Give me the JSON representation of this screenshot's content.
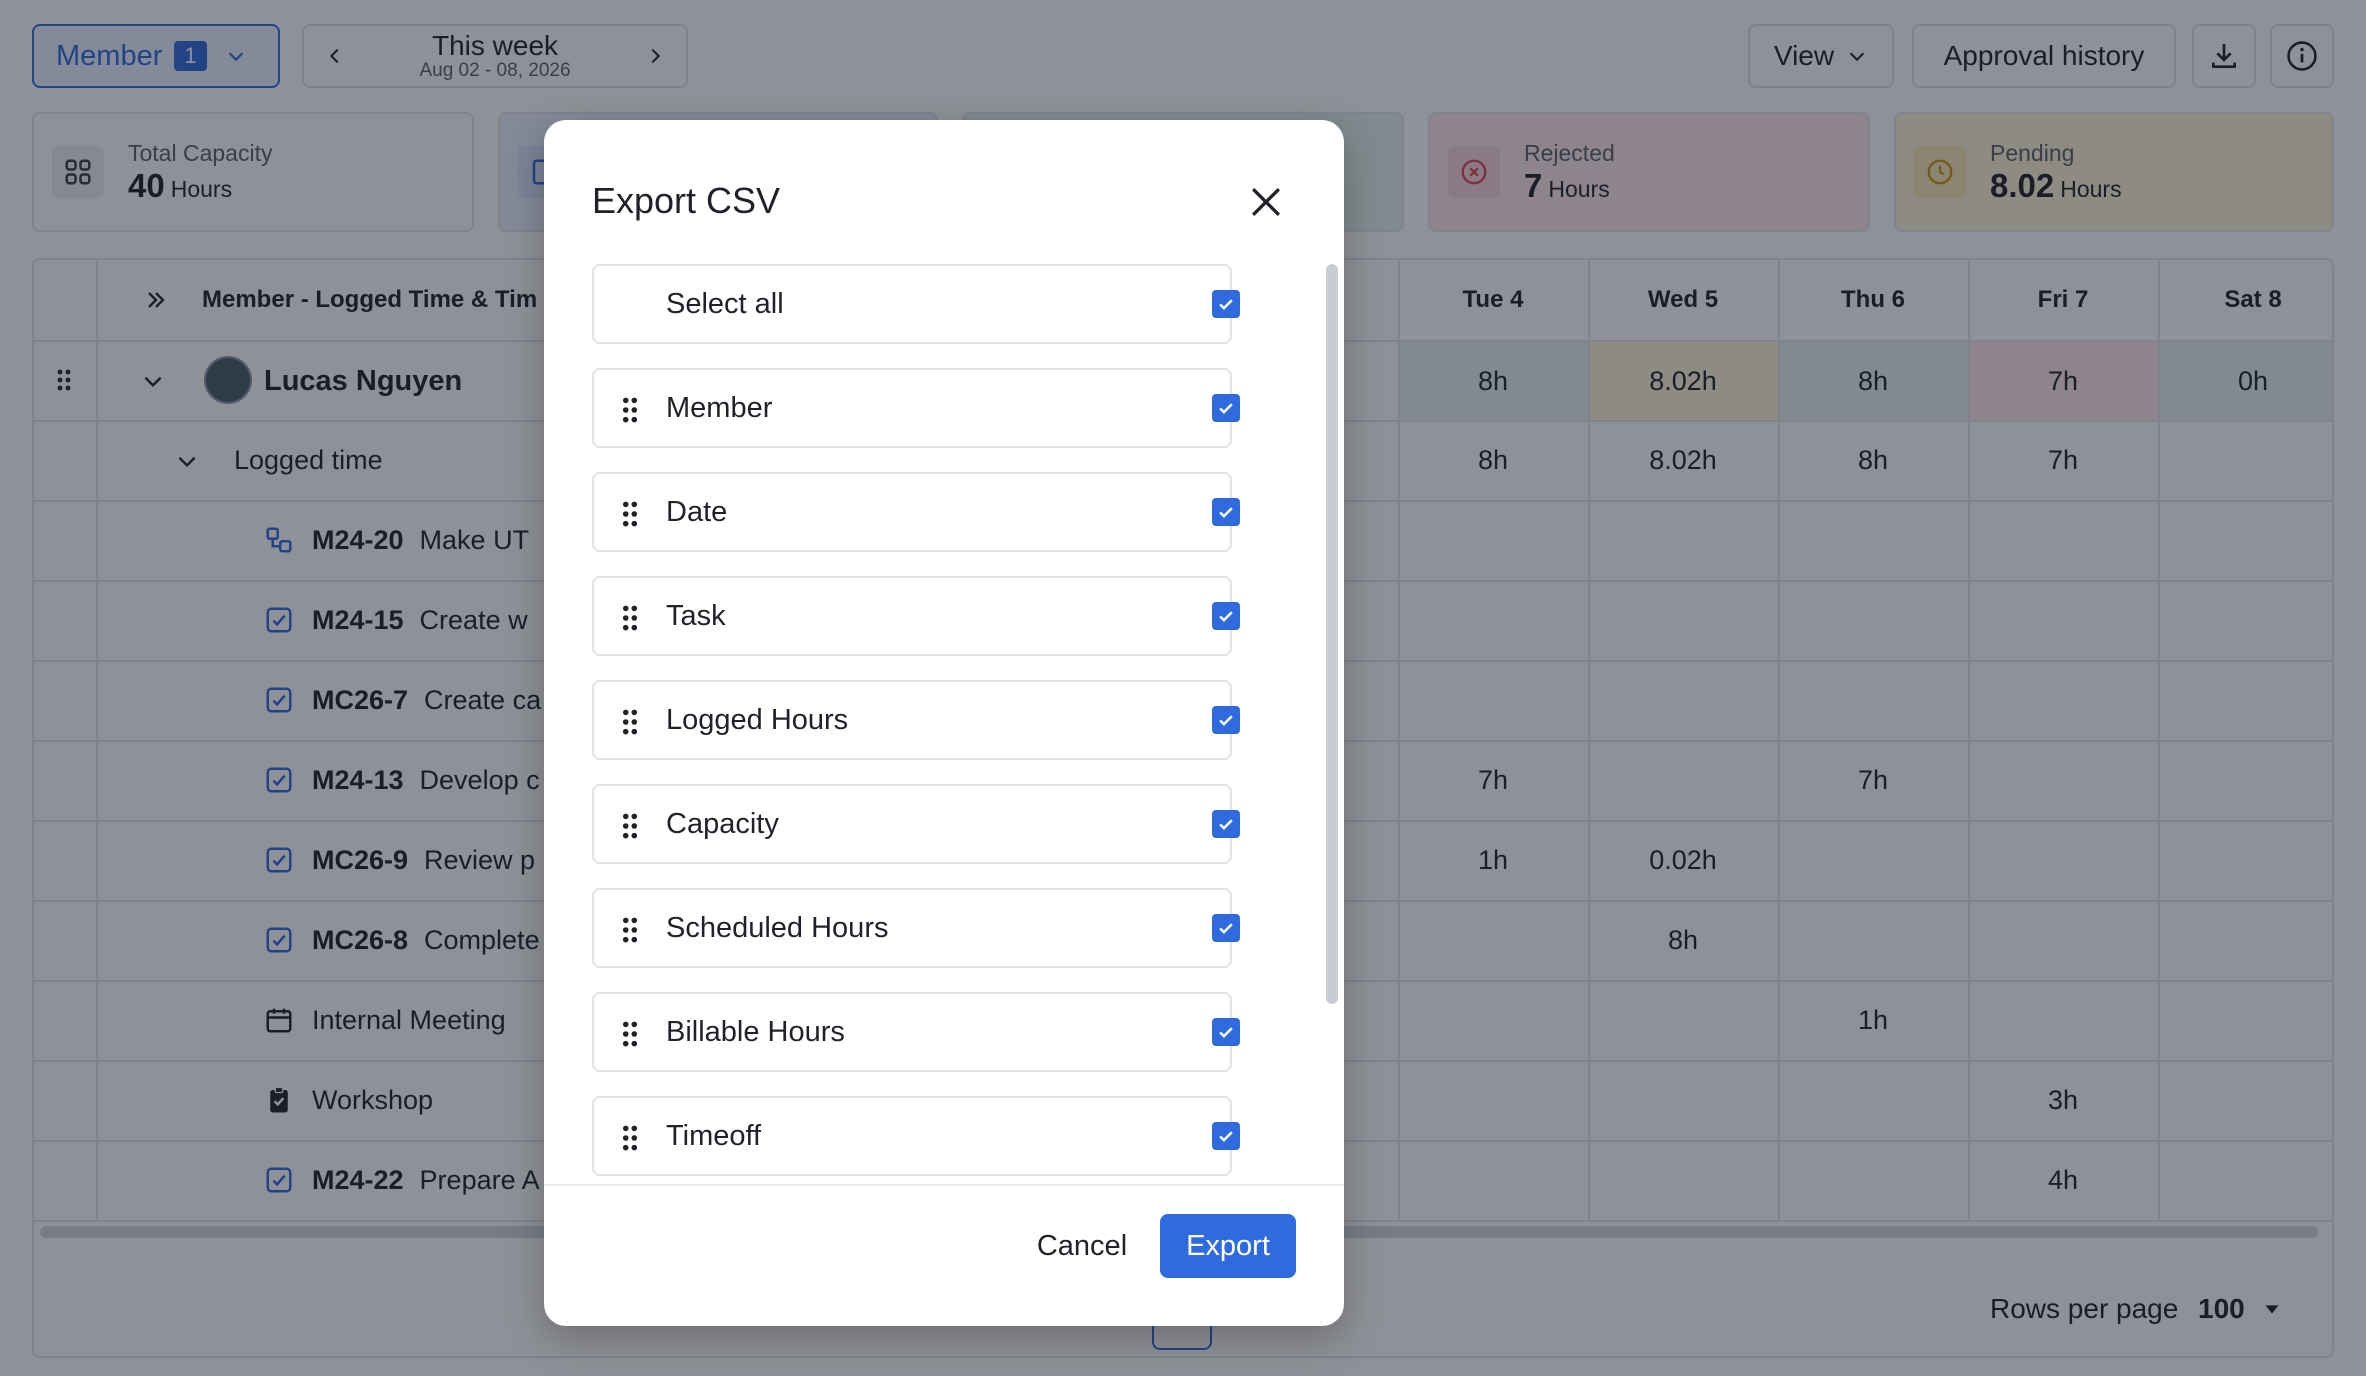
{
  "header": {
    "member_filter": {
      "label": "Member",
      "count": "1"
    },
    "week": {
      "title": "This week",
      "range": "Aug 02 - 08, 2026"
    },
    "view_label": "View",
    "approval_history_label": "Approval history"
  },
  "stats": [
    {
      "label": "Total Capacity",
      "value": "40",
      "unit": "Hours"
    },
    {
      "label": "Rejected",
      "value": "7",
      "unit": "Hours"
    },
    {
      "label": "Pending",
      "value": "8.02",
      "unit": "Hours"
    }
  ],
  "table": {
    "first_column_header": "Member - Logged Time & Tim",
    "days": [
      "Tue 4",
      "Wed 5",
      "Thu 6",
      "Fri 7",
      "Sat 8"
    ],
    "member_row": {
      "name": "Lucas Nguyen",
      "values": [
        "8h",
        "8.02h",
        "8h",
        "7h",
        "0h"
      ]
    },
    "logged_row": {
      "label": "Logged time",
      "values": [
        "8h",
        "8.02h",
        "8h",
        "7h",
        ""
      ]
    },
    "rows": [
      {
        "icon": "subtask-icon",
        "code": "M24-20",
        "title": "Make UT",
        "values": [
          "",
          "",
          "",
          "",
          ""
        ]
      },
      {
        "icon": "checkbox-task-icon",
        "code": "M24-15",
        "title": "Create w",
        "values": [
          "",
          "",
          "",
          "",
          ""
        ]
      },
      {
        "icon": "checkbox-task-icon",
        "code": "MC26-7",
        "title": "Create ca",
        "values": [
          "",
          "",
          "",
          "",
          ""
        ]
      },
      {
        "icon": "checkbox-task-icon",
        "code": "M24-13",
        "title": "Develop c",
        "values": [
          "7h",
          "",
          "7h",
          "",
          ""
        ]
      },
      {
        "icon": "checkbox-task-icon",
        "code": "MC26-9",
        "title": "Review p",
        "values": [
          "1h",
          "0.02h",
          "",
          "",
          ""
        ]
      },
      {
        "icon": "checkbox-task-icon",
        "code": "MC26-8",
        "title": "Complete",
        "values": [
          "",
          "8h",
          "",
          "",
          ""
        ]
      },
      {
        "icon": "calendar-icon",
        "code": "",
        "title": "Internal Meeting",
        "values": [
          "",
          "",
          "1h",
          "",
          ""
        ]
      },
      {
        "icon": "clipboard-icon",
        "code": "",
        "title": "Workshop",
        "values": [
          "",
          "",
          "",
          "3h",
          ""
        ]
      },
      {
        "icon": "checkbox-task-icon",
        "code": "M24-22",
        "title": "Prepare A",
        "values": [
          "",
          "",
          "",
          "4h",
          ""
        ]
      }
    ],
    "rows_per_page_label": "Rows per page",
    "rows_per_page_value": "100"
  },
  "modal": {
    "title": "Export CSV",
    "select_all_label": "Select all",
    "options": [
      "Member",
      "Date",
      "Task",
      "Logged Hours",
      "Capacity",
      "Scheduled Hours",
      "Billable Hours",
      "Timeoff"
    ],
    "cancel_label": "Cancel",
    "export_label": "Export"
  },
  "colors": {
    "accent": "#2f6bde",
    "capacity_row_green": "#e5f4ee",
    "overtime_yellow": "#fdf4d9",
    "rejected_red": "#fbe6e8",
    "pending_yellow": "#fdf3d7"
  }
}
